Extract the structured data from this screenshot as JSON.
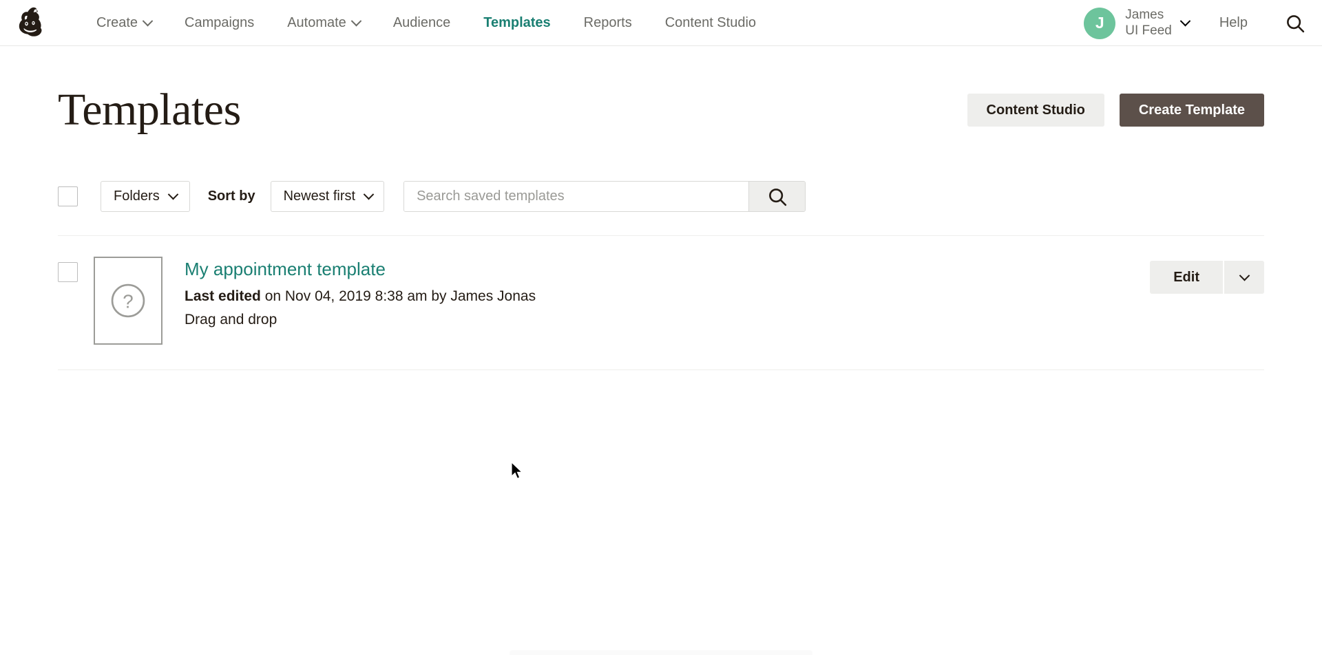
{
  "brand": {
    "logo_icon": "mailchimp-freddie-logo",
    "accent_teal": "#1a7f72",
    "avatar_green": "#6dc49c",
    "primary_button_bg": "#5c504a",
    "secondary_button_bg": "#eeeeec"
  },
  "nav": {
    "items": [
      {
        "label": "Create",
        "has_caret": true,
        "active": false
      },
      {
        "label": "Campaigns",
        "has_caret": false,
        "active": false
      },
      {
        "label": "Automate",
        "has_caret": true,
        "active": false
      },
      {
        "label": "Audience",
        "has_caret": false,
        "active": false
      },
      {
        "label": "Templates",
        "has_caret": false,
        "active": true
      },
      {
        "label": "Reports",
        "has_caret": false,
        "active": false
      },
      {
        "label": "Content Studio",
        "has_caret": false,
        "active": false
      }
    ],
    "account": {
      "avatar_initial": "J",
      "name_line1": "James",
      "name_line2": "UI Feed",
      "caret_icon": "chevron-down-icon"
    },
    "help_label": "Help",
    "search_icon": "search-icon"
  },
  "header": {
    "title": "Templates",
    "content_studio_label": "Content Studio",
    "create_template_label": "Create Template"
  },
  "toolbar": {
    "select_all_checkbox": "",
    "folders_label": "Folders",
    "sort_by_label": "Sort by",
    "sort_value": "Newest first",
    "search_placeholder": "Search saved templates",
    "search_value": "",
    "search_button_icon": "search-icon"
  },
  "templates": [
    {
      "name": "My appointment template",
      "thumbnail_icon": "question-mark-placeholder-icon",
      "meta_label": "Last edited",
      "meta_text": " on Nov 04, 2019 8:38 am by James Jonas",
      "type": "Drag and drop",
      "edit_label": "Edit",
      "menu_icon": "chevron-down-icon",
      "checked": false
    }
  ]
}
